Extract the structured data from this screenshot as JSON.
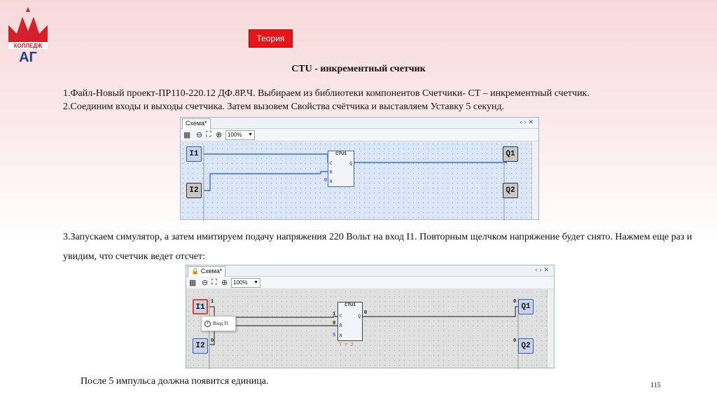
{
  "logo": {
    "text": "КОЛЛЕДЖ",
    "letters": "АГ",
    "colors": {
      "red": "#d4202a",
      "blue": "#1f3f8f"
    }
  },
  "theory_button": "Теория",
  "title": "CTU - инкрементный счетчик",
  "paragraph1": {
    "line1": "1.Файл-Новый проект-ПР110-220.12 ДФ.8Р.Ч.  Выбираем из библиотеки компонентов Счетчики- CT – инкрементный счетчик.",
    "line2": "2.Соединим входы и выходы счетчика. Затем вызовем Свойства счётчика и выставляем Уставку 5 секунд."
  },
  "paragraph2": "3.Запускаем симулятор, а затем имитируем подачу напряжения 220 Вольт на вход I1. Повторным щелчком напряжение будет снято. Нажмем еще раз и увидим, что счетчик ведет отсчет:",
  "paragraph3": "После 5 импульса должна появится единица.",
  "page_number": "115",
  "scheme1": {
    "tab": "Схема*",
    "zoom": "100%",
    "inputs": [
      "I1",
      "I2"
    ],
    "outputs": [
      "Q1",
      "Q2"
    ],
    "block": {
      "name": "CTU1",
      "pins": [
        "C",
        "R",
        "N"
      ],
      "out": "Q",
      "n_value": "0"
    }
  },
  "scheme2": {
    "tab": "Схема*",
    "zoom": "100%",
    "inputs": [
      "I1",
      "I2"
    ],
    "outputs": [
      "Q1",
      "Q2"
    ],
    "block": {
      "name": "CTU1",
      "pins": [
        "C",
        "R",
        "N"
      ],
      "out": "Q",
      "c_value": "1",
      "r_value": "0",
      "n_value": "5",
      "q_value": "0",
      "param": "T = 2"
    },
    "signals": {
      "i1": "1",
      "i2": "0",
      "q1": "0",
      "q2": "0"
    },
    "tooltip": "Вход I1"
  }
}
